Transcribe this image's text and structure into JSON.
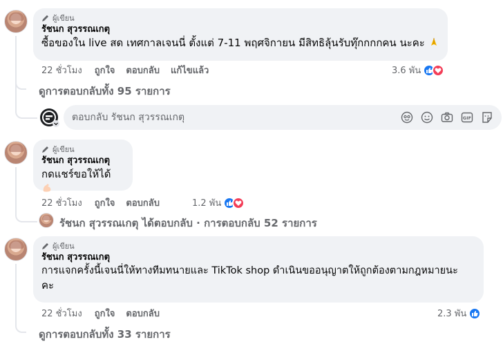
{
  "badge_label": "ผู้เขียน",
  "comments": [
    {
      "author": "รัชนก สุวรรณเกตุ",
      "text": "ซื้อของใน live สด เทศกาลเจนนี่ ตั้งแต่ 7-11 พฤศจิกายน มีสิทธิลุ้นรับทุ๊กกกกคน นะคะ",
      "emoji": "folded-hands-emoji",
      "time": "22 ชั่วโมง",
      "like": "ถูกใจ",
      "reply": "ตอบกลับ",
      "edited": "แก้ไขแล้ว",
      "reactions": "3.6 พัน",
      "replies_link": "ดูการตอบกลับทั้ง 95 รายการ"
    },
    {
      "author": "รัชนก สุวรรณเกตุ",
      "text": "กดแชร์ขอให้ได้",
      "emoji": "flexed-biceps-emoji",
      "time": "22 ชั่วโมง",
      "like": "ถูกใจ",
      "reply": "ตอบกลับ",
      "reactions": "1.2 พัน",
      "reply_summary": "รัชนก สุวรรณเกตุ ได้ตอบกลับ · การตอบกลับ 52 รายการ"
    },
    {
      "author": "รัชนก สุวรรณเกตุ",
      "text_line1": "การแจกครั้งนี้เจนนี่ให้ทางทีมทนายและ TikTok shop ดำเนินขออนุญาตให้ถูกต้องตามกฎหมายนะ",
      "text_line2": "คะ",
      "time": "22 ชั่วโมง",
      "like": "ถูกใจ",
      "reply": "ตอบกลับ",
      "reactions": "2.3 พัน",
      "replies_link": "ดูการตอบกลับทั้ง 33 รายการ"
    }
  ],
  "reply_box": {
    "placeholder": "ตอบกลับ รัชนก สุวรรณเกตุ",
    "tools": [
      "avatar-icon",
      "smiley-icon",
      "camera-icon",
      "gif-icon",
      "sticker-icon"
    ]
  },
  "colors": {
    "like": "#1877f2",
    "love": "#f33e58",
    "bubble": "#f0f2f5",
    "meta": "#65676b"
  }
}
